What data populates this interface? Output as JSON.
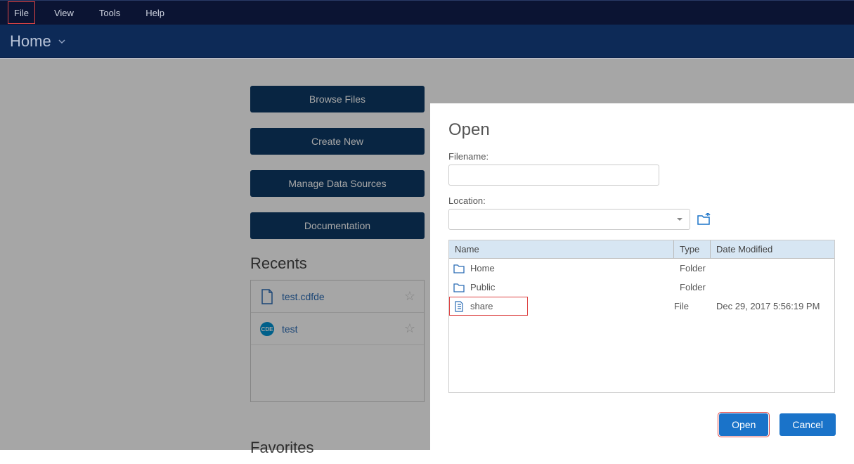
{
  "menubar": {
    "file": "File",
    "view": "View",
    "tools": "Tools",
    "help": "Help"
  },
  "perspective": {
    "label": "Home"
  },
  "home": {
    "buttons": {
      "browse": "Browse Files",
      "create": "Create New",
      "manage": "Manage Data Sources",
      "docs": "Documentation"
    },
    "recents_title": "Recents",
    "recents": [
      {
        "label": "test.cdfde",
        "icon": "file"
      },
      {
        "label": "test",
        "icon": "cde"
      }
    ],
    "favorites_title": "Favorites"
  },
  "dialog": {
    "title": "Open",
    "filename_label": "Filename:",
    "filename_value": "",
    "location_label": "Location:",
    "location_value": "",
    "columns": {
      "name": "Name",
      "type": "Type",
      "date": "Date Modified"
    },
    "rows": [
      {
        "name": "Home",
        "type": "Folder",
        "date": "",
        "icon": "folder"
      },
      {
        "name": "Public",
        "type": "Folder",
        "date": "",
        "icon": "folder"
      },
      {
        "name": "share",
        "type": "File",
        "date": "Dec 29, 2017 5:56:19 PM",
        "icon": "file"
      }
    ],
    "buttons": {
      "open": "Open",
      "cancel": "Cancel"
    }
  }
}
